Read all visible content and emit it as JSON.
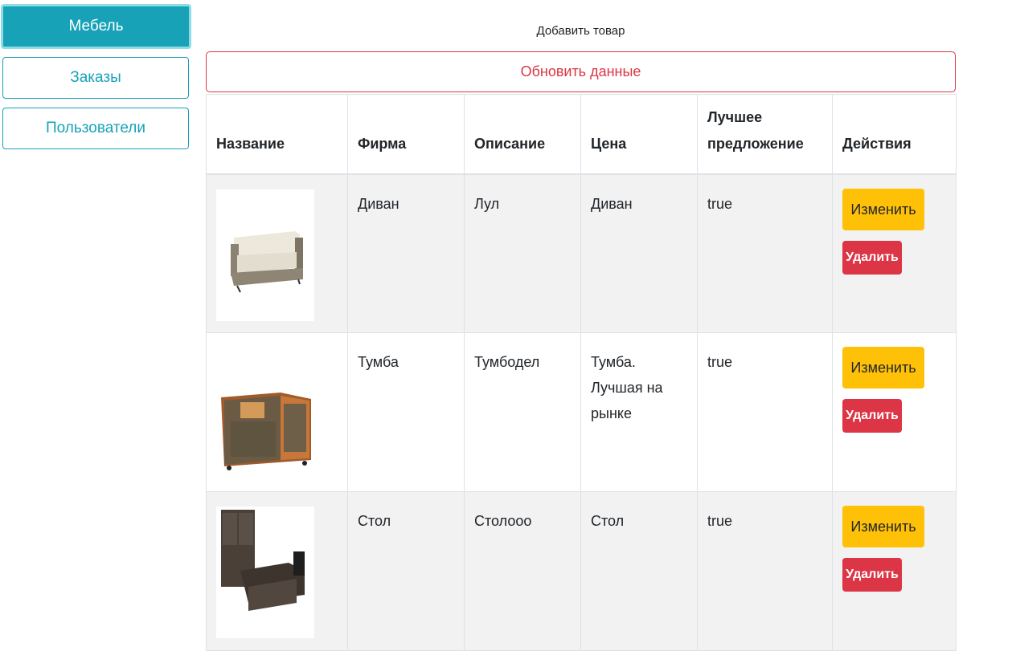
{
  "sidebar": {
    "items": [
      {
        "label": "Мебель"
      },
      {
        "label": "Заказы"
      },
      {
        "label": "Пользователи"
      }
    ]
  },
  "main": {
    "add_label": "Добавить товар",
    "refresh_label": "Обновить данные",
    "headers": [
      "Название",
      "Фирма",
      "Описание",
      "Цена",
      "Лучшее предложение",
      "Действия"
    ],
    "rows": [
      {
        "image": "sofa-image",
        "firm": "Диван",
        "description": "Лул",
        "price": "Диван",
        "best": "true",
        "edit": "Изменить",
        "delete": "Удалить"
      },
      {
        "image": "tv-stand-image",
        "firm": "Тумба",
        "description": "Тумбодел",
        "price": "Тумба. Лучшая на рынке",
        "best": "true",
        "edit": "Изменить",
        "delete": "Удалить"
      },
      {
        "image": "office-set-image",
        "firm": "Стол",
        "description": "Столооо",
        "price": "Стол",
        "best": "true",
        "edit": "Изменить",
        "delete": "Удалить"
      }
    ]
  },
  "colors": {
    "info": "#17a2b8",
    "danger": "#dc3545",
    "warning": "#ffc107"
  }
}
